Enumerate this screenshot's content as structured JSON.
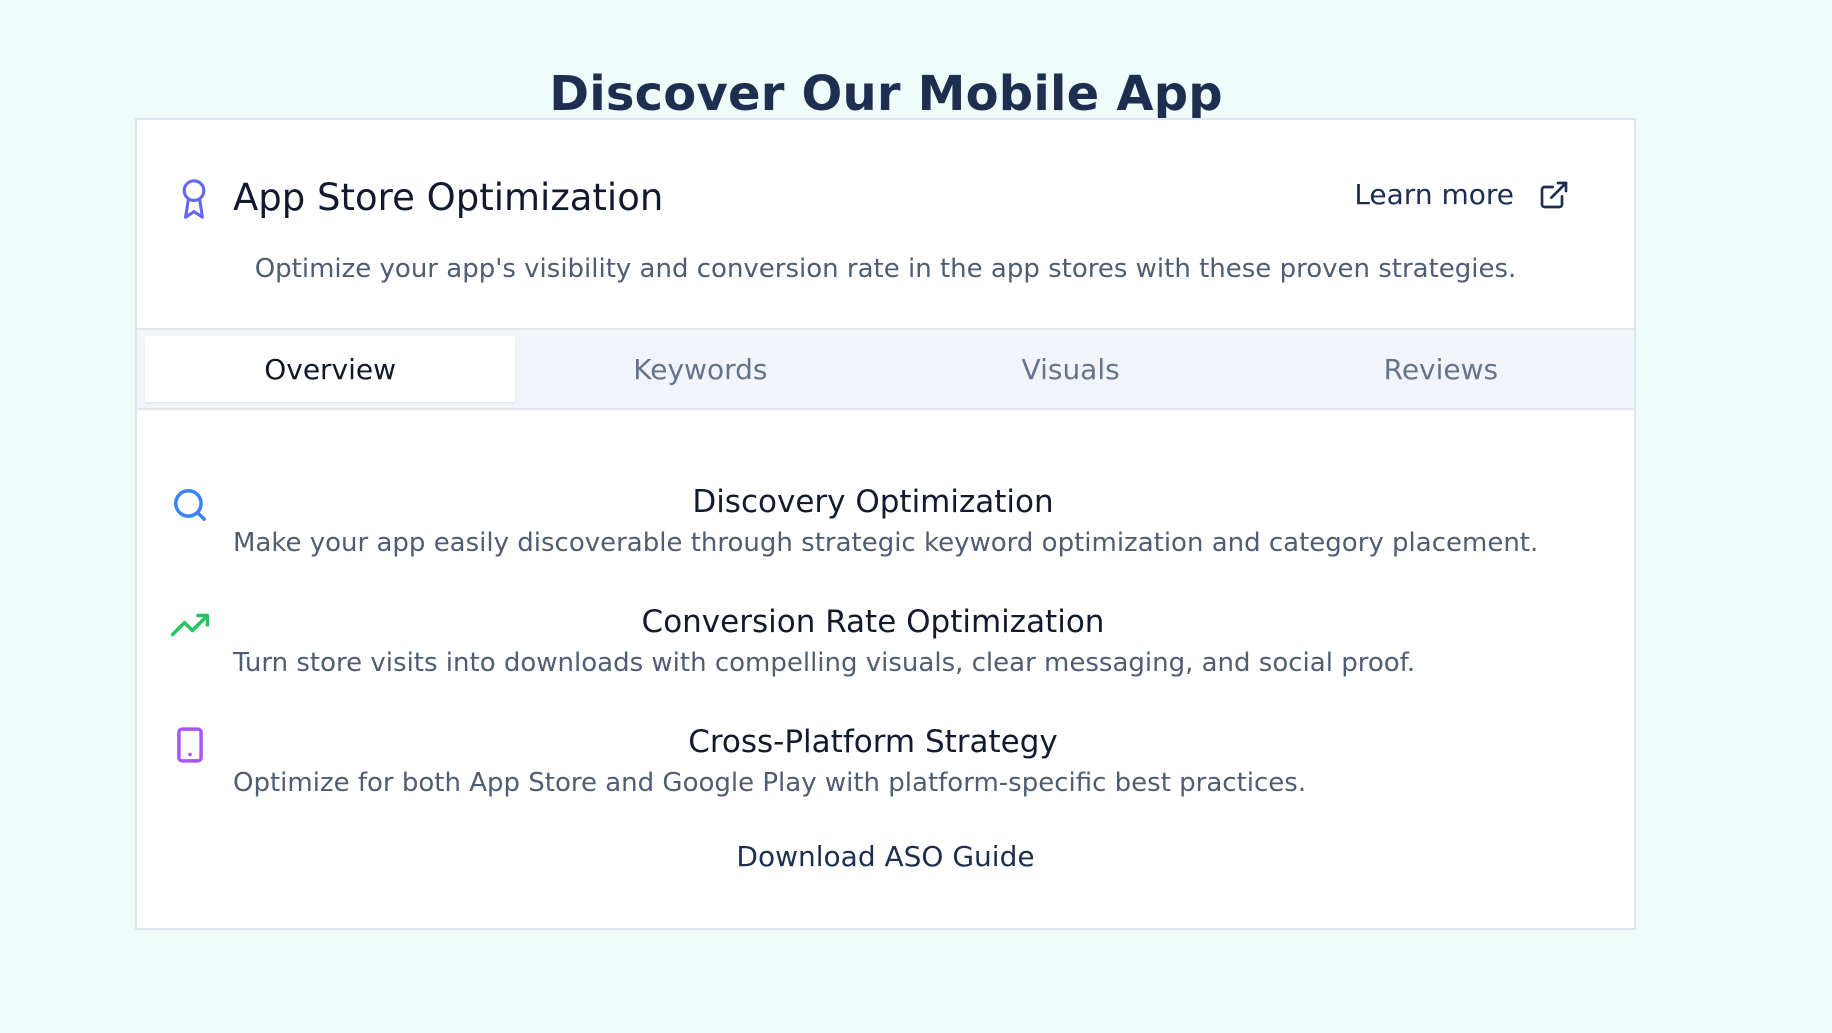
{
  "page": {
    "title": "Discover Our Mobile App"
  },
  "card": {
    "title": "App Store Optimization",
    "title_icon": "award-icon",
    "learn_more_label": "Learn more",
    "learn_more_icon": "external-link-icon",
    "description": "Optimize your app's visibility and conversion rate in the app stores with these proven strategies."
  },
  "tabs": [
    {
      "label": "Overview",
      "active": true
    },
    {
      "label": "Keywords",
      "active": false
    },
    {
      "label": "Visuals",
      "active": false
    },
    {
      "label": "Reviews",
      "active": false
    }
  ],
  "features": [
    {
      "icon": "search-icon",
      "icon_color": "#3b82f6",
      "title": "Discovery Optimization",
      "description": "Make your app easily discoverable through strategic keyword optimization and category placement."
    },
    {
      "icon": "trending-up-icon",
      "icon_color": "#22c55e",
      "title": "Conversion Rate Optimization",
      "description": "Turn store visits into downloads with compelling visuals, clear messaging, and social proof."
    },
    {
      "icon": "tablet-icon",
      "icon_color": "#a855f7",
      "title": "Cross-Platform Strategy",
      "description": "Optimize for both App Store and Google Play with platform-specific best practices."
    }
  ],
  "download_button_label": "Download ASO Guide",
  "colors": {
    "background": "#effdfa",
    "award_icon": "#6366f1",
    "heading": "#1e2e50"
  }
}
